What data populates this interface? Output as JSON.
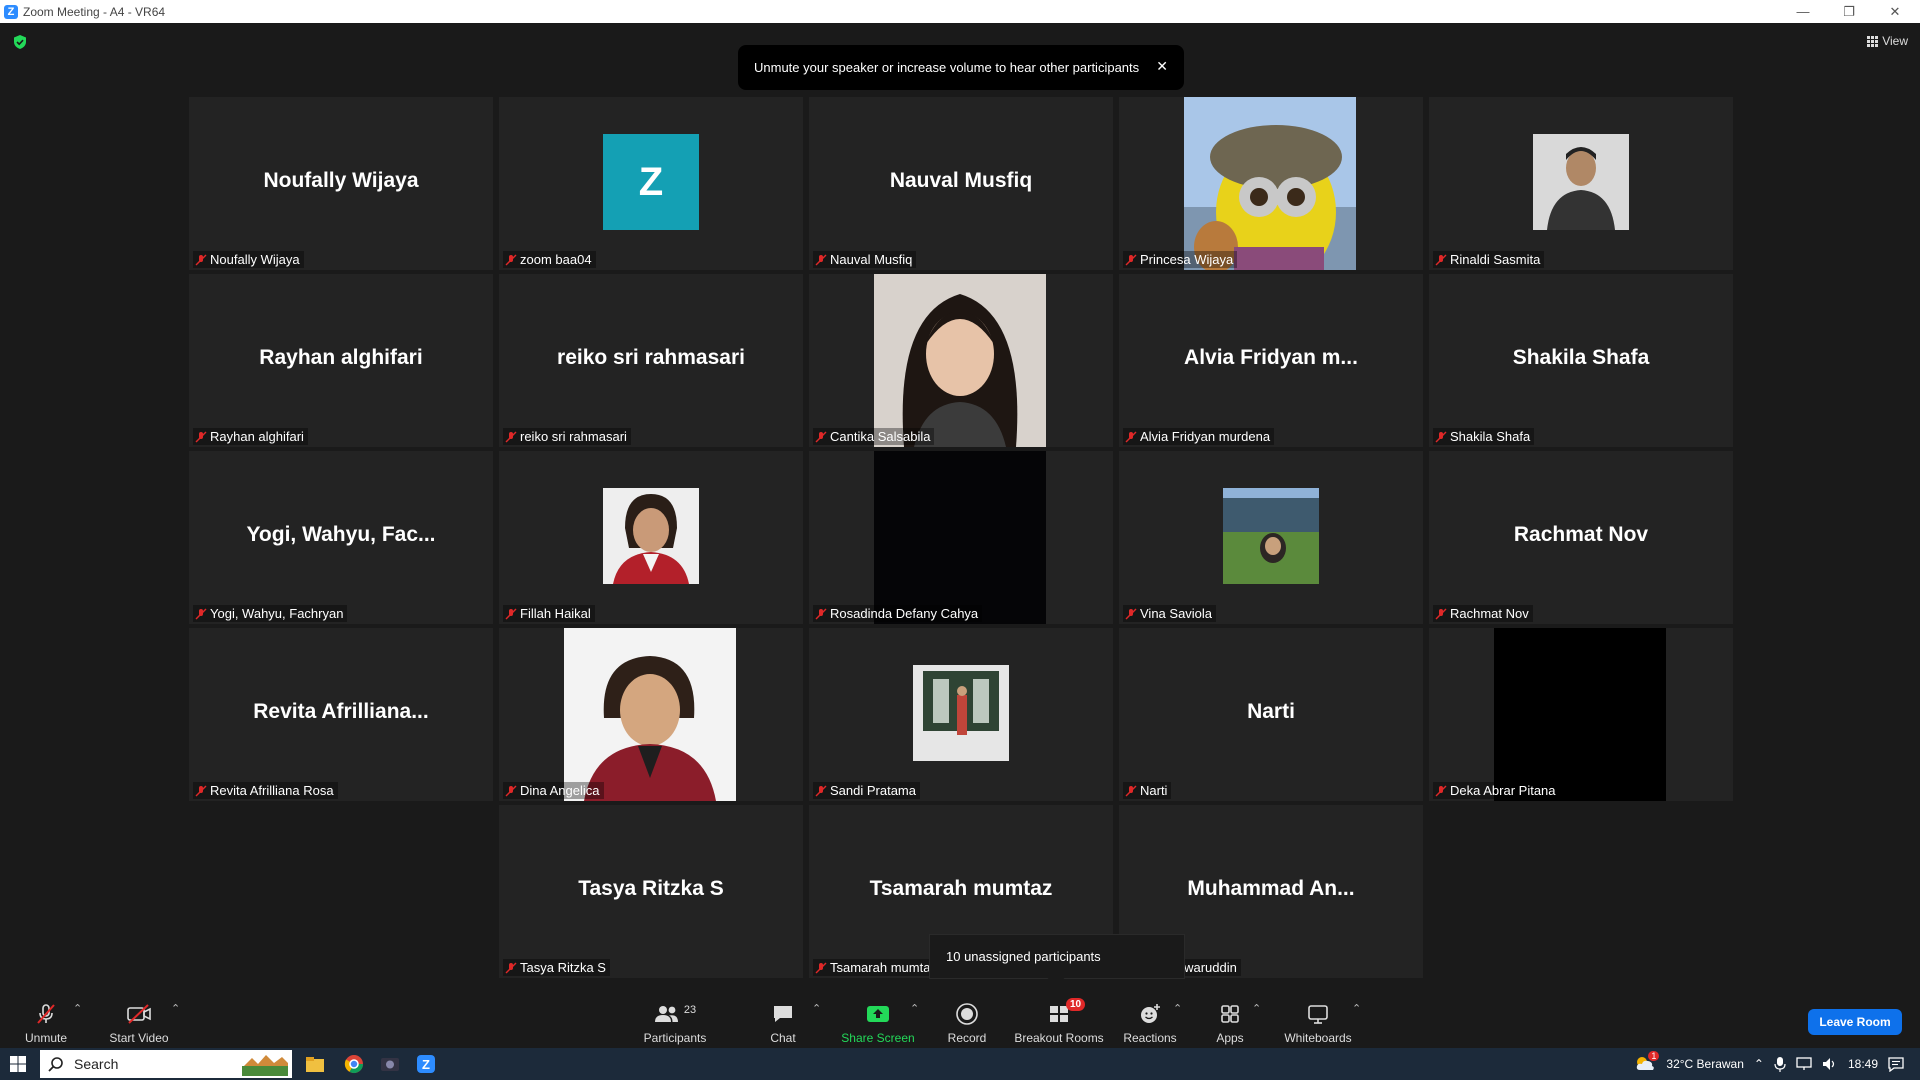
{
  "window": {
    "title": "Zoom Meeting - A4 - VR64"
  },
  "top": {
    "view_label": "View"
  },
  "toast": {
    "text": "Unmute your speaker or increase volume to hear other participants",
    "close_glyph": "✕"
  },
  "tiles": [
    {
      "big": "Noufally Wijaya",
      "name": "Noufally Wijaya"
    },
    {
      "big": "",
      "name": "zoom baa04",
      "avatar_letter": "Z"
    },
    {
      "big": "Nauval Musfiq",
      "name": "Nauval Musfiq"
    },
    {
      "big": "",
      "name": "Princesa Wijaya"
    },
    {
      "big": "",
      "name": "Rinaldi Sasmita"
    },
    {
      "big": "Rayhan alghifari",
      "name": "Rayhan alghifari"
    },
    {
      "big": "reiko sri rahmasari",
      "name": "reiko sri rahmasari"
    },
    {
      "big": "",
      "name": "Cantika Salsabila"
    },
    {
      "big": "Alvia Fridyan m...",
      "name": "Alvia Fridyan murdena"
    },
    {
      "big": "Shakila Shafa",
      "name": "Shakila Shafa"
    },
    {
      "big": "Yogi, Wahyu, Fac...",
      "name": "Yogi, Wahyu, Fachryan"
    },
    {
      "big": "",
      "name": "Fillah Haikal"
    },
    {
      "big": "",
      "name": "Rosadinda Defany Cahya"
    },
    {
      "big": "",
      "name": "Vina Saviola"
    },
    {
      "big": "Rachmat Nov",
      "name": "Rachmat Nov"
    },
    {
      "big": "Revita Afrilliana...",
      "name": "Revita Afrilliana Rosa"
    },
    {
      "big": "",
      "name": "Dina Angelica"
    },
    {
      "big": "",
      "name": "Sandi Pratama"
    },
    {
      "big": "Narti",
      "name": "Narti"
    },
    {
      "big": "",
      "name": "Deka Abrar Pitana"
    },
    {
      "big": "Tasya Ritzka S",
      "name": "Tasya Ritzka S"
    },
    {
      "big": "Tsamarah mumtaz",
      "name": "Tsamarah mumta"
    },
    {
      "big": "Muhammad An...",
      "name": "mad Anwaruddin"
    }
  ],
  "tooltip": {
    "text": "10 unassigned participants"
  },
  "toolbar": {
    "unmute": "Unmute",
    "start_video": "Start Video",
    "participants": "Participants",
    "participants_count": "23",
    "chat": "Chat",
    "share_screen": "Share Screen",
    "record": "Record",
    "breakout_rooms": "Breakout Rooms",
    "breakout_badge": "10",
    "reactions": "Reactions",
    "apps": "Apps",
    "whiteboards": "Whiteboards",
    "leave": "Leave Room"
  },
  "taskbar": {
    "search": "Search",
    "weather": "32°C  Berawan",
    "time": "18:49",
    "weather_badge": "1"
  },
  "colors": {
    "accent": "#0e71eb",
    "share_green": "#23d959",
    "mic_off_red": "#e02828"
  }
}
